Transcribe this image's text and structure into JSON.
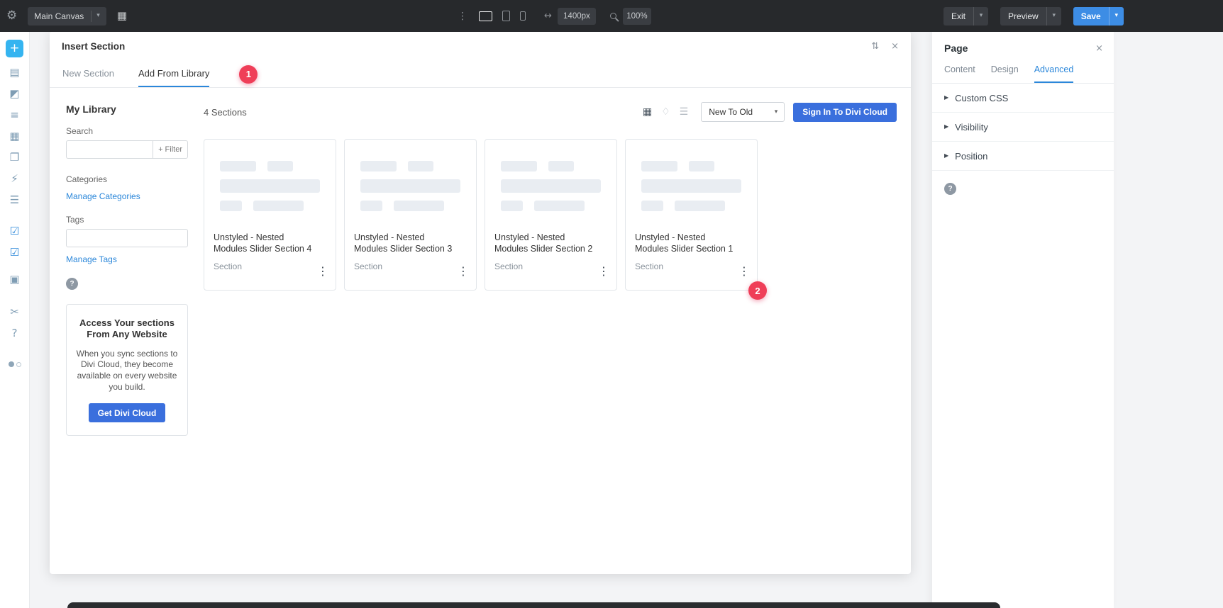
{
  "topbar": {
    "canvas_selector": "Main Canvas",
    "width_value": "1400px",
    "zoom_value": "100%",
    "exit_label": "Exit",
    "preview_label": "Preview",
    "save_label": "Save"
  },
  "icons": {
    "gear": "⚙",
    "apps_grid": "▦",
    "kebab": "⋮",
    "width_arrows": "↔",
    "chevron_down": "▾",
    "resize": "⇅",
    "close": "×",
    "view_grid": "▦",
    "view_tag": "♢",
    "view_list": "☰",
    "card_menu": "⋮",
    "caret_right": "▶",
    "help": "?"
  },
  "sidebar": {
    "items": [
      {
        "name": "add",
        "glyph": "+"
      },
      {
        "name": "layers",
        "glyph": "▤"
      },
      {
        "name": "design",
        "glyph": "◩"
      },
      {
        "name": "rows",
        "glyph": "≡"
      },
      {
        "name": "grid",
        "glyph": "▦"
      },
      {
        "name": "duplicate",
        "glyph": "❐"
      },
      {
        "name": "lightning",
        "glyph": "⚡"
      },
      {
        "name": "wireframe",
        "glyph": "☰"
      },
      {
        "name": "desktop-check",
        "glyph": "☑"
      },
      {
        "name": "tablet-check",
        "glyph": "☑"
      },
      {
        "name": "images",
        "glyph": "▣"
      },
      {
        "name": "scissors",
        "glyph": "✂"
      },
      {
        "name": "help",
        "glyph": "?"
      }
    ]
  },
  "modal": {
    "title": "Insert Section",
    "tabs": {
      "new_section": "New Section",
      "add_from_library": "Add From Library"
    },
    "badges": {
      "step1": "1",
      "step2": "2"
    },
    "library": {
      "heading": "My Library",
      "search_label": "Search",
      "filter_button": "+ Filter",
      "categories_label": "Categories",
      "manage_categories_link": "Manage Categories",
      "tags_label": "Tags",
      "manage_tags_link": "Manage Tags",
      "promo_title": "Access Your sections From Any Website",
      "promo_body": "When you sync sections to Divi Cloud, they become available on every website you build.",
      "promo_button": "Get Divi Cloud"
    },
    "results": {
      "count_label": "4 Sections",
      "sort_value": "New To Old",
      "signin_button": "Sign In To Divi Cloud",
      "cards": [
        {
          "title": "Unstyled - Nested Modules Slider Section 4",
          "type": "Section"
        },
        {
          "title": "Unstyled - Nested Modules Slider Section 3",
          "type": "Section"
        },
        {
          "title": "Unstyled - Nested Modules Slider Section 2",
          "type": "Section"
        },
        {
          "title": "Unstyled - Nested Modules Slider Section 1",
          "type": "Section"
        }
      ]
    }
  },
  "page_panel": {
    "title": "Page",
    "tabs": {
      "content": "Content",
      "design": "Design",
      "advanced": "Advanced"
    },
    "sections": [
      {
        "label": "Custom CSS"
      },
      {
        "label": "Visibility"
      },
      {
        "label": "Position"
      }
    ]
  },
  "colors": {
    "accent_blue": "#2b87da",
    "button_blue": "#3a6fdd",
    "save_blue": "#3d8de5",
    "badge_red": "#ef3e58",
    "topbar_dark": "#27292c"
  }
}
